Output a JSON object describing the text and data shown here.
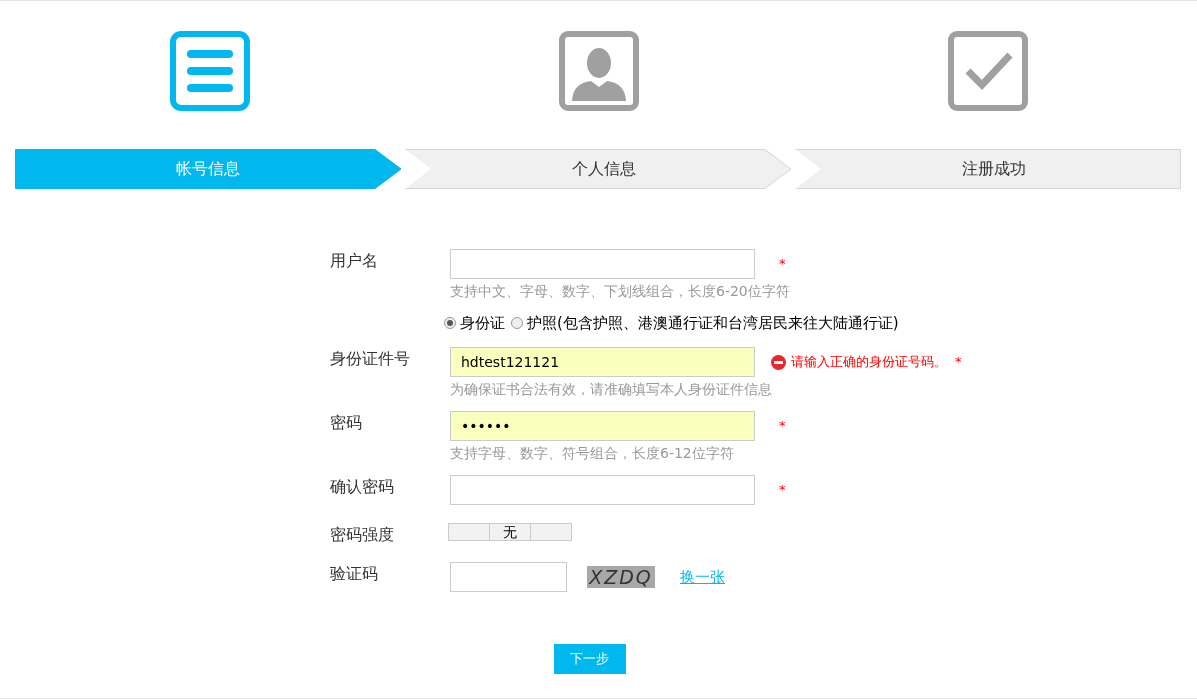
{
  "steps": [
    {
      "label": "帐号信息",
      "selected": true
    },
    {
      "label": "个人信息",
      "selected": false
    },
    {
      "label": "注册成功",
      "selected": false
    }
  ],
  "form": {
    "rows": [
      {
        "kind": "text",
        "label": "用户名",
        "value": "",
        "autofill": false,
        "required": "*",
        "hint": "支持中文、字母、数字、下划线组合，长度6-20位字符"
      },
      {
        "kind": "radio",
        "options": [
          {
            "label": "身份证",
            "selected": true
          },
          {
            "label": "护照(包含护照、港澳通行证和台湾居民来往大陆通行证)",
            "selected": false
          }
        ]
      },
      {
        "kind": "text",
        "label": "身份证件号",
        "value": "hdtest121121",
        "autofill": true,
        "error": "请输入正确的身份证号码。",
        "required": "*",
        "hint": "为确保证书合法有效，请准确填写本人身份证件信息"
      },
      {
        "kind": "text",
        "label": "密码",
        "value": "••••••",
        "autofill": true,
        "required": "*",
        "hint": "支持字母、数字、符号组合，长度6-12位字符"
      },
      {
        "kind": "text",
        "label": "确认密码",
        "value": "",
        "autofill": false,
        "required": "*"
      },
      {
        "kind": "strength",
        "label": "密码强度",
        "reading": "无"
      },
      {
        "kind": "captcha",
        "label": "验证码",
        "value": "",
        "captcha": "XZDQ",
        "link": "换一张"
      }
    ]
  },
  "button": "下一步"
}
